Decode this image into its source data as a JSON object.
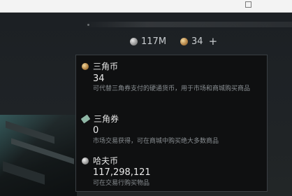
{
  "top_bar": {
    "coins_amount": "117M",
    "coupon_amount": "34",
    "plus_symbol": "+"
  },
  "tooltip": {
    "items": [
      {
        "name": "三角币",
        "value": "34",
        "description": "可代替三角券支付的硬通货币，用于市场和商城购买商品",
        "icon": "triangle-coin-icon"
      },
      {
        "name": "三角券",
        "value": "0",
        "description": "市场交易获得，可在商城中购买绝大多数商品",
        "icon": "triangle-coupon-icon"
      },
      {
        "name": "哈夫币",
        "value": "117,298,121",
        "description": "可在交易行购买物品",
        "icon": "haf-coin-icon"
      }
    ]
  }
}
